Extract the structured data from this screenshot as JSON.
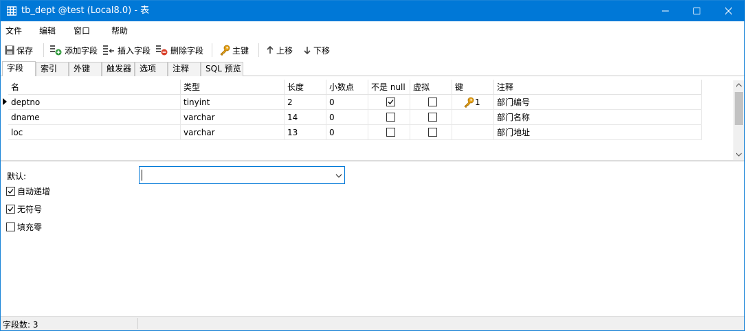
{
  "window": {
    "title": "tb_dept @test (Local8.0) - 表",
    "accent": "#0078d7"
  },
  "menu": [
    "文件",
    "编辑",
    "窗口",
    "帮助"
  ],
  "toolbar": {
    "save": "保存",
    "add_field": "添加字段",
    "insert_field": "插入字段",
    "delete_field": "删除字段",
    "primary_key": "主键",
    "move_up": "上移",
    "move_down": "下移"
  },
  "tabs": [
    "字段",
    "索引",
    "外键",
    "触发器",
    "选项",
    "注释",
    "SQL 预览"
  ],
  "active_tab": "字段",
  "grid": {
    "columns": [
      "名",
      "类型",
      "长度",
      "小数点",
      "不是 null",
      "虚拟",
      "键",
      "注释"
    ],
    "rows": [
      {
        "name": "deptno",
        "type": "tinyint",
        "length": "2",
        "decimals": "0",
        "not_null": true,
        "virtual": false,
        "key": "1",
        "comment": "部门编号"
      },
      {
        "name": "dname",
        "type": "varchar",
        "length": "14",
        "decimals": "0",
        "not_null": false,
        "virtual": false,
        "key": "",
        "comment": "部门名称"
      },
      {
        "name": "loc",
        "type": "varchar",
        "length": "13",
        "decimals": "0",
        "not_null": false,
        "virtual": false,
        "key": "",
        "comment": "部门地址"
      }
    ]
  },
  "properties": {
    "default_label": "默认:",
    "default_value": "",
    "auto_increment": {
      "label": "自动递增",
      "checked": true
    },
    "unsigned": {
      "label": "无符号",
      "checked": true
    },
    "zerofill": {
      "label": "填充零",
      "checked": false
    }
  },
  "status": {
    "field_count": "字段数: 3"
  }
}
